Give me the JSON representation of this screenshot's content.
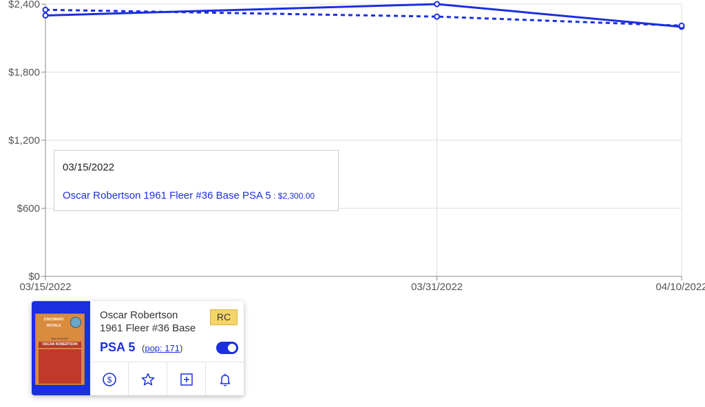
{
  "chart_data": {
    "type": "line",
    "x": [
      "03/15/2022",
      "03/31/2022",
      "04/10/2022"
    ],
    "series": [
      {
        "name": "Oscar Robertson 1961 Fleer #36 Base PSA 5",
        "style": "solid",
        "values": [
          2300,
          2400,
          2200
        ]
      },
      {
        "style": "dashed",
        "values": [
          2350,
          2290,
          2210
        ]
      }
    ],
    "ylim": [
      0,
      2400
    ],
    "yticks": [
      "$0",
      "$600",
      "$1,200",
      "$1,800",
      "$2,400"
    ],
    "ytick_values": [
      0,
      600,
      1200,
      1800,
      2400
    ],
    "grid": true,
    "color": "#1a2fe0"
  },
  "tooltip": {
    "date": "03/15/2022",
    "label": "Oscar Robertson 1961 Fleer #36 Base PSA 5",
    "separator": " : ",
    "value": "$2,300.00"
  },
  "card": {
    "player_name": "Oscar Robertson",
    "set_name": "1961 Fleer #36 Base",
    "badge": "RC",
    "grade": "PSA 5",
    "pop_open": "(",
    "pop_link": "pop: 171",
    "pop_close": ")",
    "toggle_on": true,
    "image_team": "CINCINNATI ROYALS",
    "image_position": "BACKCOURT",
    "image_name": "OSCAR ROBERTSON",
    "actions": [
      "dollar-icon",
      "star-icon",
      "add-to-collection-icon",
      "bell-icon"
    ]
  }
}
